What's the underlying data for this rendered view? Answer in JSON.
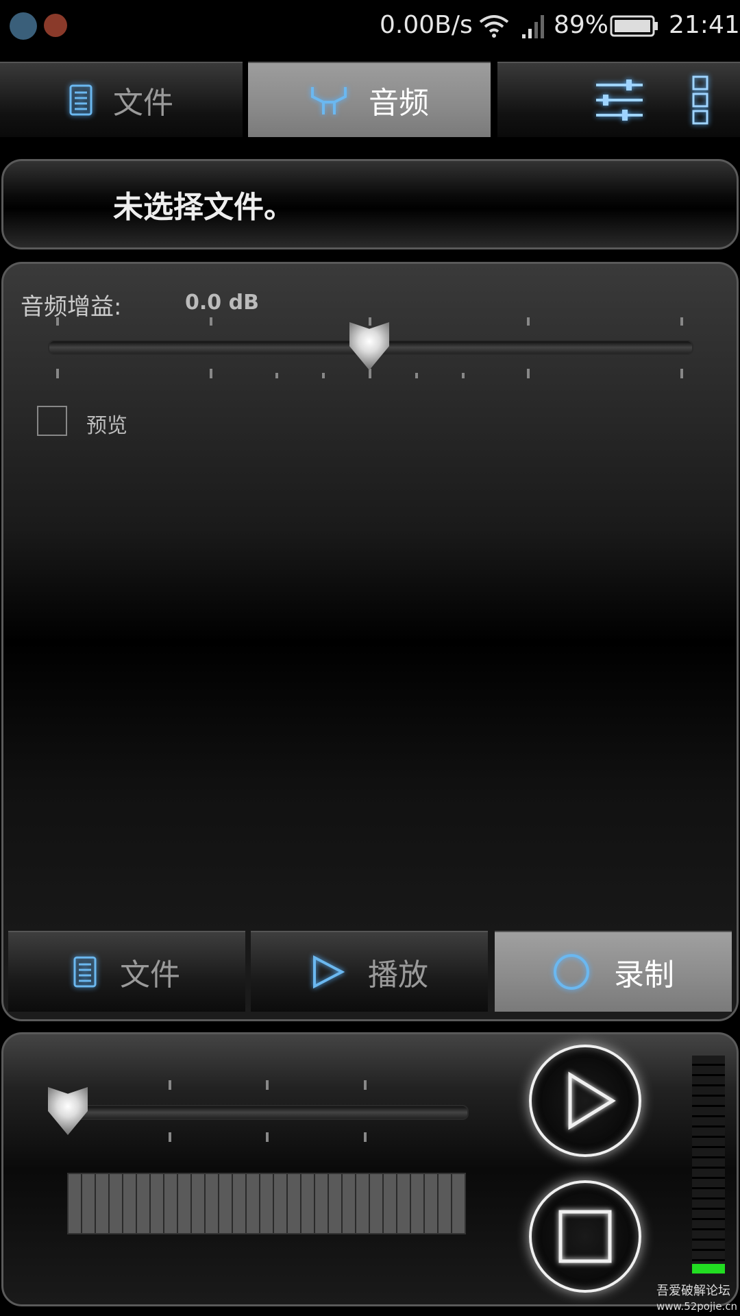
{
  "status_bar": {
    "net_speed": "0.00B/s",
    "battery": "89%",
    "time": "21:41",
    "icons": [
      "screenshot-icon",
      "app-icon",
      "wifi-icon",
      "signal-icon",
      "battery-icon"
    ]
  },
  "top_tabs": [
    {
      "label": "文件",
      "icon": "document-icon",
      "active": false
    },
    {
      "label": "音频",
      "icon": "tuning-fork-icon",
      "active": true
    }
  ],
  "toolbar": {
    "icons": [
      "equalizer-icon",
      "grid-menu-icon"
    ]
  },
  "file_status": "未选择文件。",
  "gain": {
    "label": "音频增益:",
    "value_text": "0.0 dB",
    "level": 0.5
  },
  "preview": {
    "label": "预览",
    "checked": false
  },
  "bottom_tabs": [
    {
      "label": "文件",
      "icon": "document-icon",
      "active": false
    },
    {
      "label": "播放",
      "icon": "play-icon",
      "active": false
    },
    {
      "label": "录制",
      "icon": "record-icon",
      "active": true
    }
  ],
  "player": {
    "position": 0.0,
    "play_button": "play-icon",
    "stop_button": "stop-icon"
  },
  "watermark": {
    "line1": "吾爱破解论坛",
    "line2": "www.52pojie.cn"
  },
  "colors": {
    "accent_blue": "#5ab4ff",
    "vu_green": "#22dd22"
  }
}
